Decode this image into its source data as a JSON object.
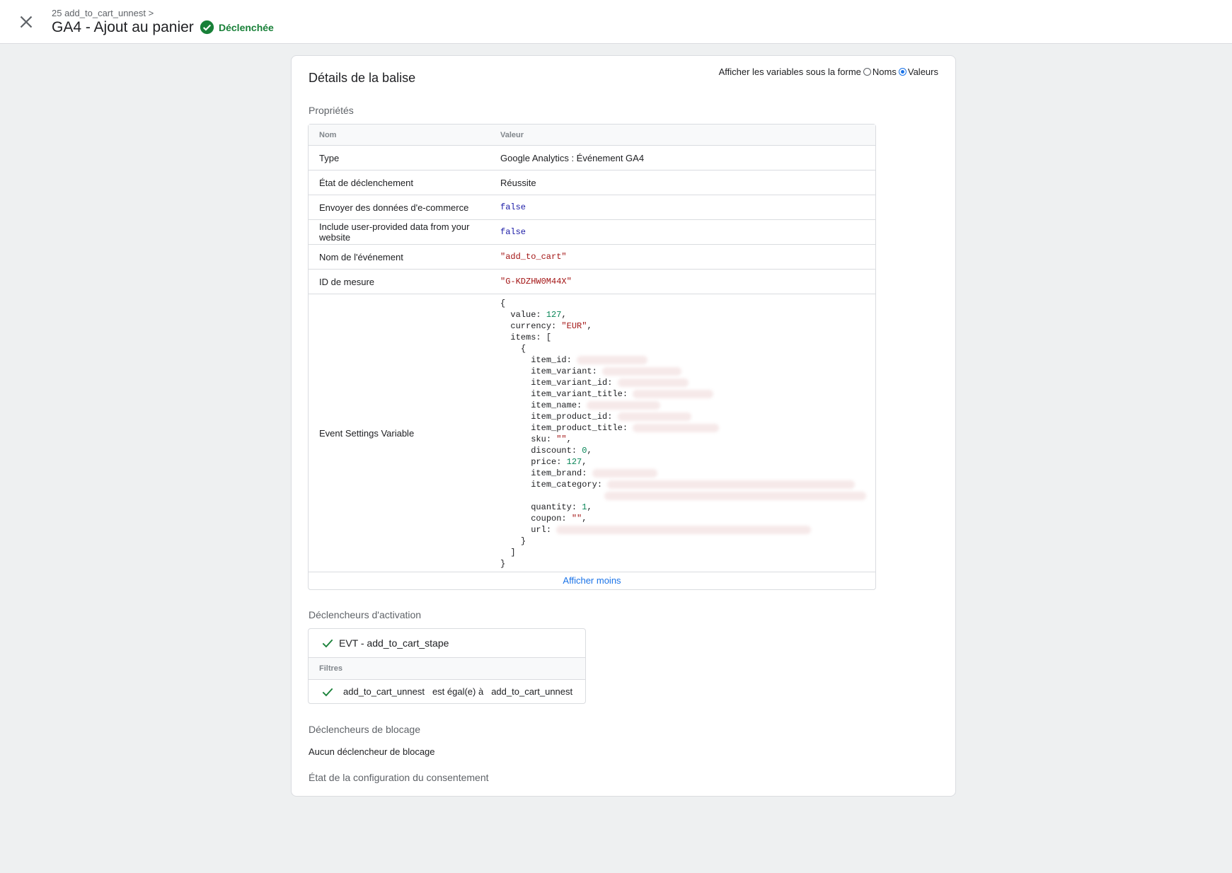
{
  "header": {
    "breadcrumb": "25 add_to_cart_unnest >",
    "title": "GA4 - Ajout au panier",
    "status": "Déclenchée"
  },
  "details": {
    "title": "Détails de la balise",
    "var_form_label": "Afficher les variables sous la forme",
    "option_names": "Noms",
    "option_values": "Valeurs",
    "selected_option": "Valeurs"
  },
  "properties": {
    "section_label": "Propriétés",
    "col_name": "Nom",
    "col_value": "Valeur",
    "rows": [
      {
        "name": "Type",
        "value": "Google Analytics : Événement GA4"
      },
      {
        "name": "État de déclenchement",
        "value": "Réussite"
      },
      {
        "name": "Envoyer des données d'e-commerce",
        "value": "false"
      },
      {
        "name": "Include user-provided data from your website",
        "value": "false"
      },
      {
        "name": "Nom de l'événement",
        "value": "\"add_to_cart\""
      },
      {
        "name": "ID de mesure",
        "value": "\"G-KDZHW0M44X\""
      },
      {
        "name": "Event Settings Variable",
        "value": ""
      }
    ],
    "event_settings": {
      "open_brace": "{",
      "value_key": "value:",
      "value": "127",
      "currency_key": "currency:",
      "currency": "\"EUR\"",
      "items_key": "items: [",
      "item_open": "{",
      "item_id_key": "item_id:",
      "item_variant_key": "item_variant:",
      "item_variant_id_key": "item_variant_id:",
      "item_variant_title_key": "item_variant_title:",
      "item_name_key": "item_name:",
      "item_product_id_key": "item_product_id:",
      "item_product_title_key": "item_product_title:",
      "sku_key": "sku:",
      "sku": "\"\"",
      "discount_key": "discount:",
      "discount": "0",
      "price_key": "price:",
      "price": "127",
      "item_brand_key": "item_brand:",
      "item_category_key": "item_category:",
      "quantity_key": "quantity:",
      "quantity": "1",
      "coupon_key": "coupon:",
      "coupon": "\"\"",
      "url_key": "url:",
      "item_close": "}",
      "items_close": "]",
      "close_brace": "}"
    },
    "show_less": "Afficher moins"
  },
  "triggers": {
    "section_label": "Déclencheurs d'activation",
    "trigger_name": "EVT - add_to_cart_stape",
    "filters_label": "Filtres",
    "filter": {
      "variable": "add_to_cart_unnest",
      "operator": "est égal(e) à",
      "value": "add_to_cart_unnest"
    }
  },
  "blocking": {
    "section_label": "Déclencheurs de blocage",
    "none_text": "Aucun déclencheur de blocage"
  },
  "consent": {
    "section_label": "État de la configuration du consentement"
  },
  "colors": {
    "success": "#188038",
    "link": "#1a73e8",
    "keyword": "#1a1aa6",
    "string": "#a31515",
    "number": "#098658"
  }
}
